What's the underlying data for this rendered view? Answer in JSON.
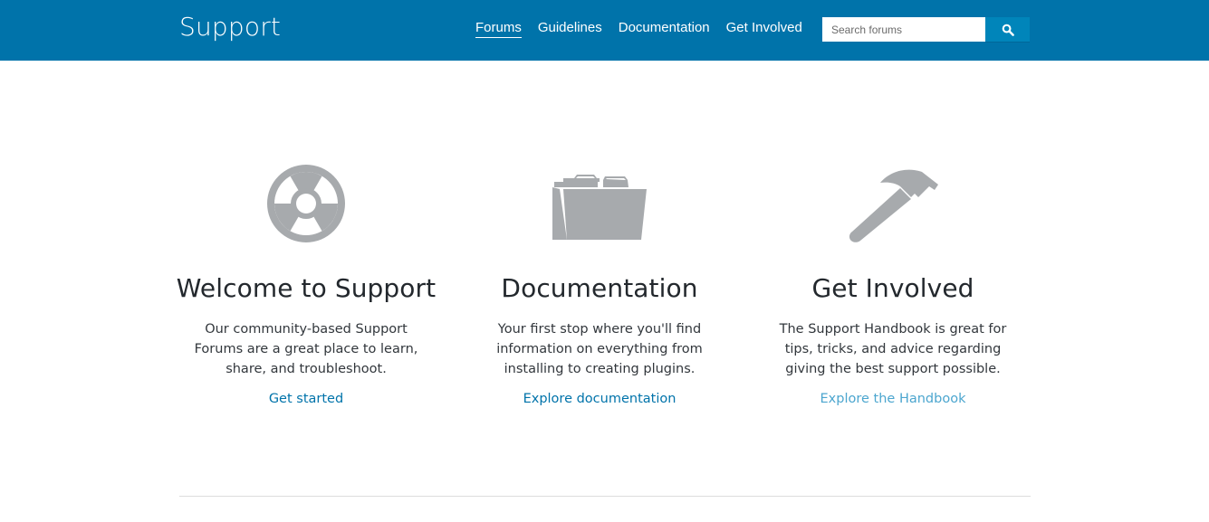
{
  "header": {
    "site_title": "Support",
    "background_color": "#0073aa",
    "nav": [
      {
        "label": "Forums",
        "active": true
      },
      {
        "label": "Guidelines",
        "active": false
      },
      {
        "label": "Documentation",
        "active": false
      },
      {
        "label": "Get Involved",
        "active": false
      }
    ],
    "search": {
      "placeholder": "Search forums",
      "value": "",
      "button_icon": "search-icon"
    }
  },
  "columns": [
    {
      "icon": "lifebuoy-icon",
      "title": "Welcome to Support",
      "description": "Our community-based Support Forums are a great place to learn, share, and troubleshoot.",
      "link_label": "Get started"
    },
    {
      "icon": "folder-icon",
      "title": "Documentation",
      "description": "Your first stop where you'll find information on everything from installing to creating plugins.",
      "link_label": "Explore documentation"
    },
    {
      "icon": "hammer-icon",
      "title": "Get Involved",
      "description": "The Support Handbook is great for tips, tricks, and advice regarding giving the best support possible.",
      "link_label": "Explore the Handbook"
    }
  ],
  "colors": {
    "icon_gray": "#a7aaad",
    "link_blue": "#0073aa",
    "link_hover_blue": "#4ca6cf"
  }
}
